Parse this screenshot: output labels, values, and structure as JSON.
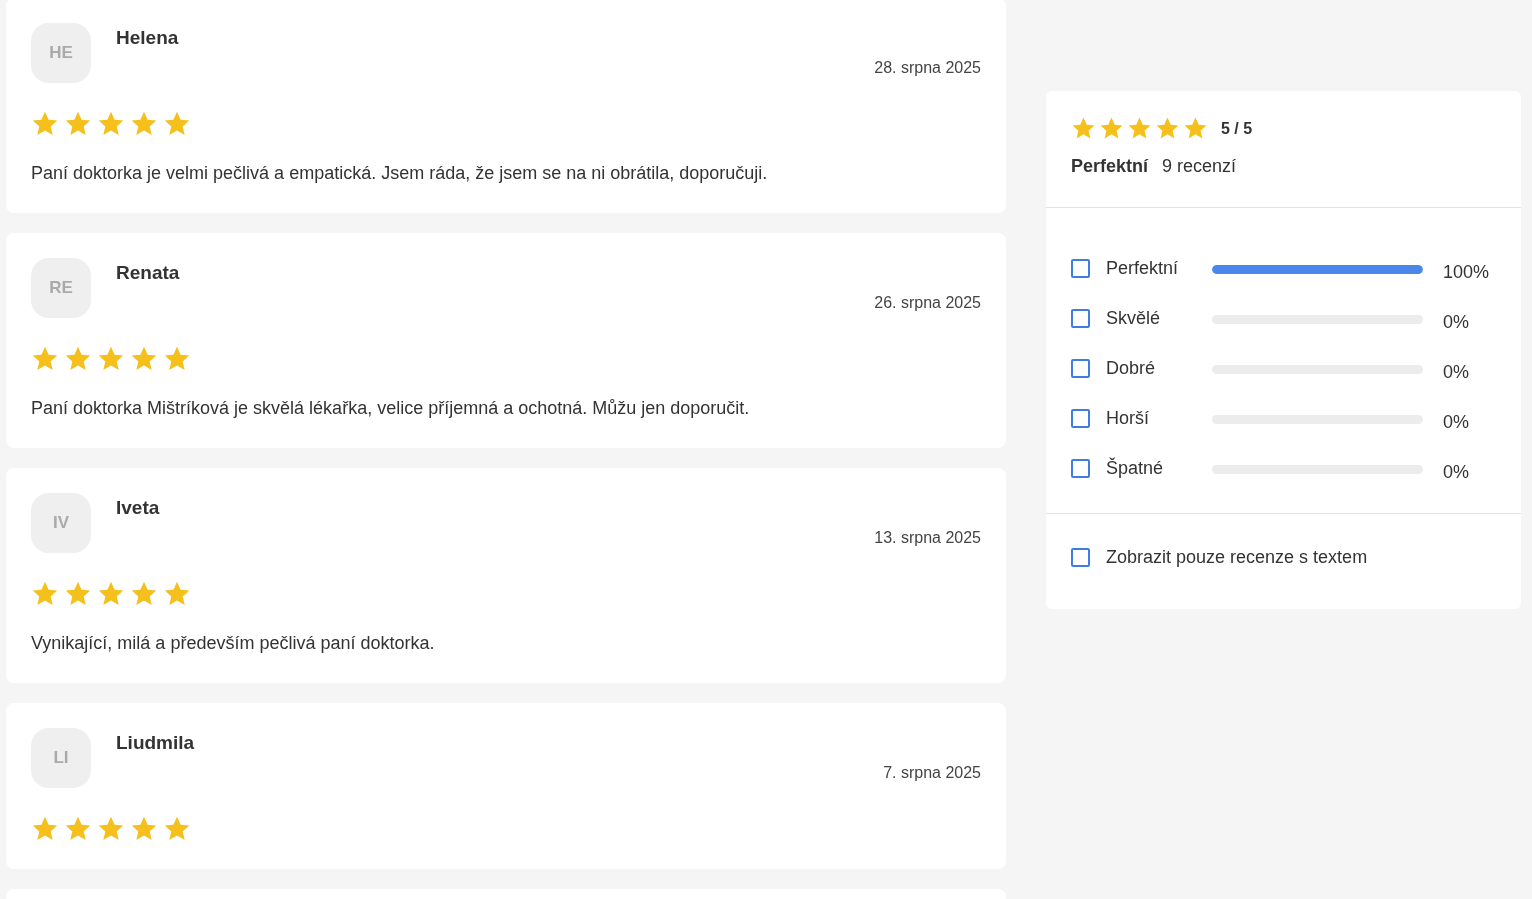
{
  "reviews": [
    {
      "initials": "HE",
      "name": "Helena",
      "date": "28. srpna 2025",
      "stars": 5,
      "text": "Paní doktorka je velmi pečlivá a empatická. Jsem ráda, že jsem se na ni obrátila, doporučuji."
    },
    {
      "initials": "RE",
      "name": "Renata",
      "date": "26. srpna 2025",
      "stars": 5,
      "text": "Paní doktorka Mištríková je skvělá lékařka, velice příjemná a ochotná. Můžu jen doporučit."
    },
    {
      "initials": "IV",
      "name": "Iveta",
      "date": "13. srpna 2025",
      "stars": 5,
      "text": "Vynikající, milá a především pečlivá paní doktorka."
    },
    {
      "initials": "LI",
      "name": "Liudmila",
      "date": "7. srpna 2025",
      "stars": 5
    }
  ],
  "summary": {
    "stars": 5,
    "score": "5 / 5",
    "verdict": "Perfektní",
    "count": "9 recenzí",
    "filters": [
      {
        "label": "Perfektní",
        "checked": false,
        "level": 1,
        "percent": "100%"
      },
      {
        "label": "Skvělé",
        "checked": false,
        "level": 0,
        "percent": "0%"
      },
      {
        "label": "Dobré",
        "checked": false,
        "level": 0,
        "percent": "0%"
      },
      {
        "label": "Horší",
        "checked": false,
        "level": 0,
        "percent": "0%"
      },
      {
        "label": "Špatné",
        "checked": false,
        "level": 0,
        "percent": "0%"
      }
    ],
    "text_only": {
      "label": "Zobrazit pouze recenze s textem",
      "checked": false
    }
  }
}
